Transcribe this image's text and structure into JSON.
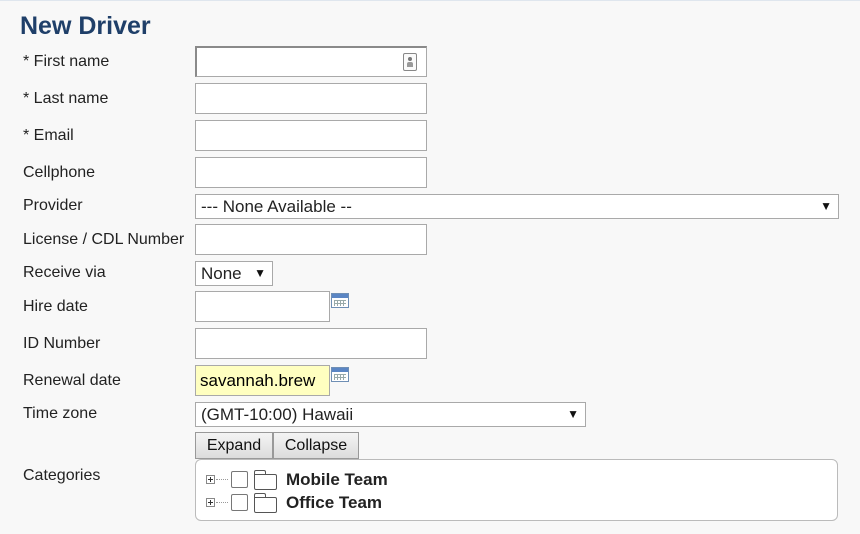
{
  "page_title": "New Driver",
  "fields": {
    "first_name": {
      "label": "* First name",
      "value": ""
    },
    "last_name": {
      "label": "* Last name",
      "value": ""
    },
    "email": {
      "label": "* Email",
      "value": ""
    },
    "cellphone": {
      "label": "Cellphone",
      "value": ""
    },
    "provider": {
      "label": "Provider",
      "selected": "--- None Available --"
    },
    "license": {
      "label": "License / CDL Number",
      "value": ""
    },
    "receive_via": {
      "label": "Receive via",
      "selected": "None"
    },
    "hire_date": {
      "label": "Hire date",
      "value": ""
    },
    "id_number": {
      "label": "ID Number",
      "value": ""
    },
    "renewal_date": {
      "label": "Renewal date",
      "value": "savannah.brew",
      "highlight_color": "#ffffc0"
    },
    "time_zone": {
      "label": "Time zone",
      "selected": "(GMT-10:00) Hawaii"
    }
  },
  "categories": {
    "label": "Categories",
    "expand_label": "Expand",
    "collapse_label": "Collapse",
    "items": [
      {
        "name": "Mobile Team",
        "checked": false
      },
      {
        "name": "Office Team",
        "checked": false
      }
    ]
  },
  "icons": {
    "contact": "contact-card-icon",
    "calendar": "calendar-icon",
    "folder": "folder-icon",
    "expand": "plus-expander-icon",
    "dropdown": "chevron-down-icon"
  },
  "colors": {
    "title": "#1f3f69",
    "background": "#f8f8f8"
  }
}
